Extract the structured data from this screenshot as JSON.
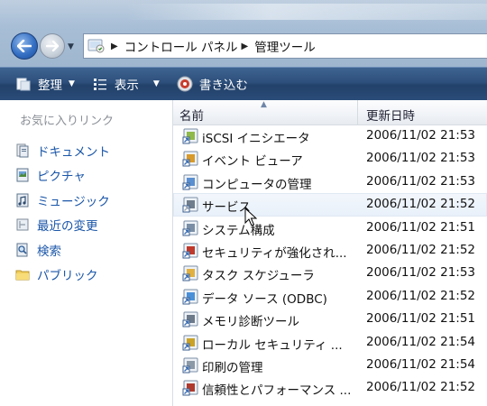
{
  "address": {
    "breadcrumbs": [
      "コントロール パネル",
      "管理ツール"
    ]
  },
  "toolbar": {
    "organize_label": "整理",
    "views_label": "表示",
    "burn_label": "書き込む"
  },
  "favorites": {
    "heading": "お気に入りリンク",
    "items": [
      {
        "label": "ドキュメント",
        "icon": "documents-icon"
      },
      {
        "label": "ピクチャ",
        "icon": "pictures-icon"
      },
      {
        "label": "ミュージック",
        "icon": "music-icon"
      },
      {
        "label": "最近の変更",
        "icon": "recent-changes-icon"
      },
      {
        "label": "検索",
        "icon": "search-folder-icon"
      },
      {
        "label": "パブリック",
        "icon": "public-folder-icon"
      }
    ]
  },
  "files": {
    "columns": {
      "name": "名前",
      "date": "更新日時"
    },
    "rows": [
      {
        "name": "iSCSI イニシエータ",
        "date": "2006/11/02 21:53",
        "icon": "iscsi-shortcut-icon"
      },
      {
        "name": "イベント ビューア",
        "date": "2006/11/02 21:53",
        "icon": "event-viewer-shortcut-icon"
      },
      {
        "name": "コンピュータの管理",
        "date": "2006/11/02 21:53",
        "icon": "computer-management-shortcut-icon"
      },
      {
        "name": "サービス",
        "date": "2006/11/02 21:52",
        "icon": "services-shortcut-icon"
      },
      {
        "name": "システム構成",
        "date": "2006/11/02 21:51",
        "icon": "system-config-shortcut-icon"
      },
      {
        "name": "セキュリティが強化され...",
        "date": "2006/11/02 21:52",
        "icon": "firewall-shortcut-icon"
      },
      {
        "name": "タスク スケジューラ",
        "date": "2006/11/02 21:53",
        "icon": "task-scheduler-shortcut-icon"
      },
      {
        "name": "データ ソース (ODBC)",
        "date": "2006/11/02 21:52",
        "icon": "odbc-shortcut-icon"
      },
      {
        "name": "メモリ診断ツール",
        "date": "2006/11/02 21:51",
        "icon": "memory-diagnostic-shortcut-icon"
      },
      {
        "name": "ローカル セキュリティ ...",
        "date": "2006/11/02 21:54",
        "icon": "local-security-shortcut-icon"
      },
      {
        "name": "印刷の管理",
        "date": "2006/11/02 21:54",
        "icon": "print-management-shortcut-icon"
      },
      {
        "name": "信頼性とパフォーマンス ...",
        "date": "2006/11/02 21:52",
        "icon": "reliability-shortcut-icon"
      }
    ],
    "hover_row": 3
  }
}
